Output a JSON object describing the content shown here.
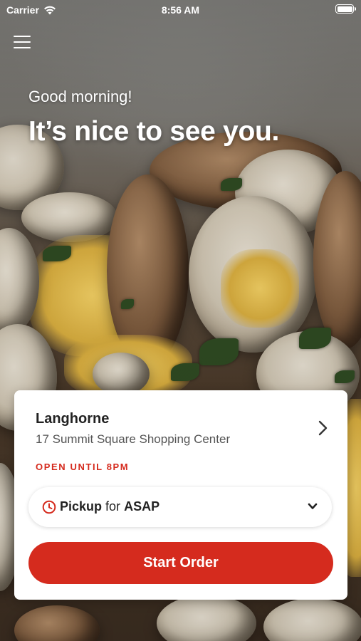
{
  "status_bar": {
    "carrier": "Carrier",
    "time": "8:56 AM"
  },
  "header": {
    "menu_icon": "hamburger-menu-icon",
    "greeting": "Good morning!",
    "headline": "It’s nice to see you."
  },
  "store": {
    "name": "Langhorne",
    "address": "17 Summit Square Shopping Center",
    "hours": "OPEN UNTIL 8PM",
    "chevron_icon": "chevron-right-icon"
  },
  "order_mode": {
    "icon": "clock-icon",
    "mode": "Pickup",
    "connector": "for",
    "time": "ASAP",
    "dropdown_icon": "chevron-down-icon"
  },
  "actions": {
    "start_order_label": "Start Order"
  },
  "colors": {
    "brand_red": "#d52b1e",
    "card_background": "#ffffff",
    "text_primary": "#222222",
    "text_secondary": "#555555"
  }
}
